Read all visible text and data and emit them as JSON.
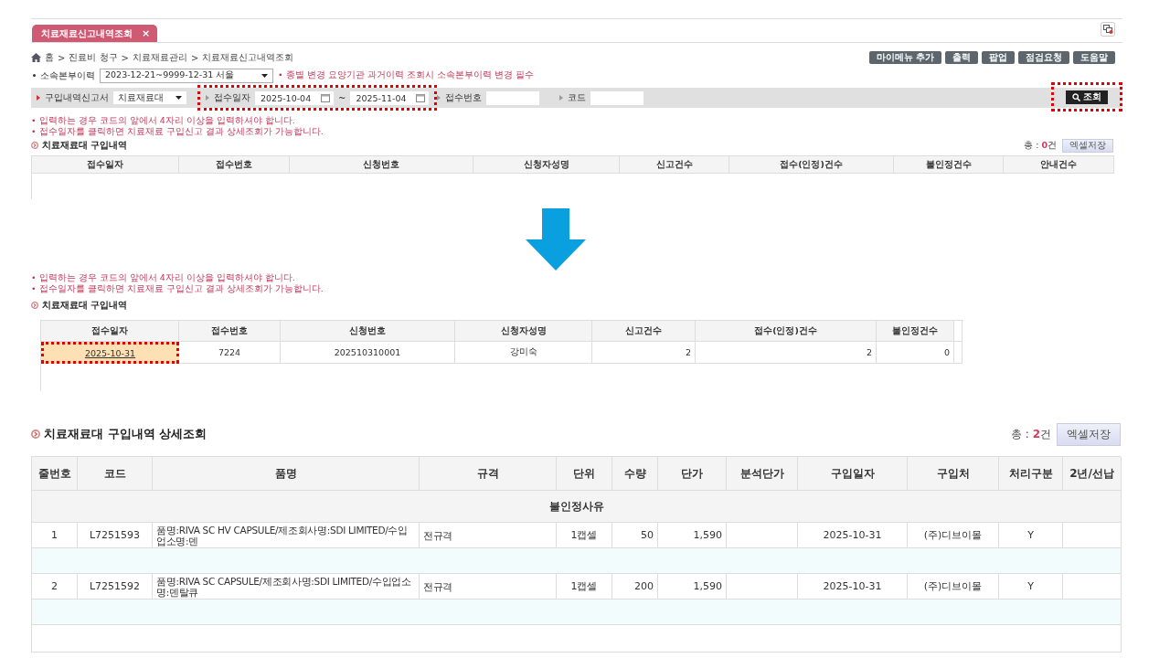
{
  "tab": {
    "label": "치료재료신고내역조회",
    "close": "×",
    "selected": true
  },
  "breadcrumb": {
    "separator": ">",
    "items": [
      "홈",
      "진료비 청구",
      "치료재료관리",
      "치료재료신고내역조회"
    ]
  },
  "toolbar_buttons": [
    "마이메뉴 추가",
    "출력",
    "팝업",
    "점검요청",
    "도움말"
  ],
  "affiliation": {
    "label": "소속본부이력",
    "value": "2023-12-21~9999-12-31 서울",
    "notice": "• 종별 변경 요양기관 과거이력 조회시 소속본부이력 변경 필수"
  },
  "filters": [
    {
      "kind": "select",
      "label": "구입내역신고서",
      "value": "치료재료대"
    },
    {
      "kind": "date_range",
      "label": "접수일자",
      "from": "2025-10-04",
      "separator": "~",
      "to": "2025-11-04",
      "highlight": true
    },
    {
      "kind": "text",
      "label": "접수번호"
    },
    {
      "kind": "text",
      "label": "코드"
    }
  ],
  "search_button": {
    "label": "조회",
    "highlight": true
  },
  "notes": [
    "• 입력하는 경우 코드의 앞에서 4자리 이상을 입력하셔야 합니다.",
    "• 접수일자를 클릭하면 치료재료 구입신고 결과 상세조회가 가능합니다."
  ],
  "summary": {
    "title": "치료재료대 구입내역",
    "total_label": "총 :",
    "total": "0",
    "total_unit": "건",
    "excel_button": "엑셀저장",
    "columns": [
      "접수일자",
      "접수번호",
      "신청번호",
      "신청자성명",
      "신고건수",
      "접수(인정)건수",
      "불인정건수",
      "안내건수"
    ]
  },
  "result": {
    "notes": [
      "• 입력하는 경우 코드의 앞에서 4자리 이상을 입력하셔야 합니다.",
      "• 접수일자를 클릭하면 치료재료 구입신고 결과 상세조회가 가능합니다."
    ],
    "title": "치료재료대 구입내역",
    "columns": [
      "접수일자",
      "접수번호",
      "신청번호",
      "신청자성명",
      "신고건수",
      "접수(인정)건수",
      "불인정건수"
    ],
    "rows": [
      {
        "cells": [
          "2025-10-31",
          "7224",
          "202510310001",
          "강미숙",
          "2",
          "2",
          "0"
        ],
        "highlight": true
      }
    ]
  },
  "detail": {
    "title": "치료재료대 구입내역 상세조회",
    "total_label": "총 :",
    "total": "2",
    "total_unit": "건",
    "excel_button": "엑셀저장",
    "columns": [
      "줄번호",
      "코드",
      "품명",
      "규격",
      "단위",
      "수량",
      "단가",
      "분석단가",
      "구입일자",
      "구입처",
      "처리구분",
      "2년/선납"
    ],
    "reason_header": "불인정사유",
    "rows": [
      {
        "cells": [
          "1",
          "L7251593",
          "품명:RIVA SC HV CAPSULE/제조회사명:SDI LIMITED/수입업소명:덴",
          "전규격",
          "1캡셀",
          "50",
          "1,590",
          null,
          "2025-10-31",
          "(주)디브이몰",
          "Y",
          null
        ]
      },
      {
        "cells": [
          "2",
          "L7251592",
          "품명:RIVA SC CAPSULE/제조회사명:SDI LIMITED/수입업소명:덴탈큐",
          "전규격",
          "1캡셀",
          "200",
          "1,590",
          null,
          "2025-10-31",
          "(주)디브이몰",
          "Y",
          null
        ]
      }
    ]
  }
}
